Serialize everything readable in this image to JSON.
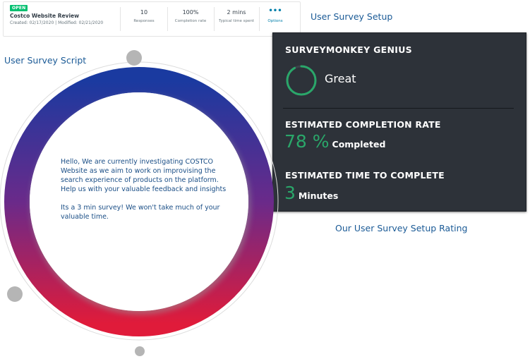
{
  "survey_card": {
    "status": "OPEN",
    "title": "Costco Website Review",
    "dates": "Created: 02/17/2020   |   Modified: 02/21/2020",
    "stats": [
      {
        "value": "10",
        "label": "Responses"
      },
      {
        "value": "100%",
        "label": "Completion rate"
      },
      {
        "value": "2 mins",
        "label": "Typical time spent"
      }
    ],
    "options_icon": "more-dots-icon",
    "options_label": "Options"
  },
  "captions": {
    "setup": "User Survey Setup",
    "script": "User Survey Script",
    "rating": "Our User Survey Setup Rating"
  },
  "genius": {
    "title": "SURVEYMONKEY GENIUS",
    "score_label": "Great",
    "ring_fill_fraction": 0.92,
    "completion_heading": "ESTIMATED COMPLETION RATE",
    "completion_value": "78 %",
    "completion_unit": "Completed",
    "time_heading": "ESTIMATED TIME TO COMPLETE",
    "time_value": "3",
    "time_unit": "Minutes"
  },
  "script": {
    "paragraph_1": "Hello, We are currently investigating COSTCO Website as we aim to work on improvising the search experience of products on the platform. Help us with your valuable feedback and insights",
    "paragraph_2": "Its a 3 min survey! We won't take much of your valuable time."
  },
  "colors": {
    "accent_green": "#2aa76a",
    "panel_bg": "#2d3239",
    "ring_top": "#1a3aa0",
    "ring_bottom": "#e01b3a",
    "caption_blue": "#1a5a96"
  }
}
